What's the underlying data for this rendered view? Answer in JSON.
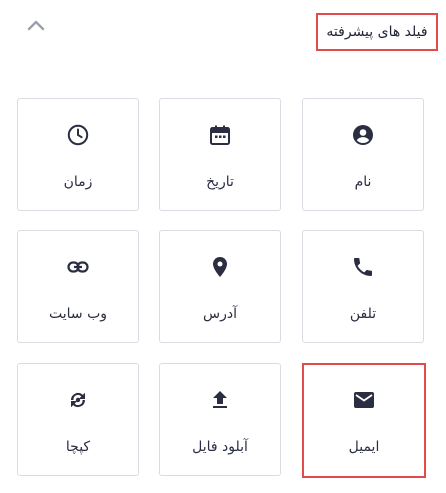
{
  "section": {
    "title": "فیلد های پیشرفته",
    "collapse_icon": "chevron-up-icon"
  },
  "fields": [
    {
      "id": "name",
      "label": "نام",
      "icon": "account-circle-icon"
    },
    {
      "id": "date",
      "label": "تاریخ",
      "icon": "calendar-icon"
    },
    {
      "id": "time",
      "label": "زمان",
      "icon": "clock-icon"
    },
    {
      "id": "phone",
      "label": "تلفن",
      "icon": "phone-icon"
    },
    {
      "id": "address",
      "label": "آدرس",
      "icon": "map-pin-icon"
    },
    {
      "id": "website",
      "label": "وب سایت",
      "icon": "link-icon"
    },
    {
      "id": "email",
      "label": "ایمیل",
      "icon": "mail-icon",
      "highlighted": true
    },
    {
      "id": "upload",
      "label": "آبلود فایل",
      "icon": "upload-icon"
    },
    {
      "id": "captcha",
      "label": "کپچا",
      "icon": "captcha-icon"
    }
  ],
  "colors": {
    "icon": "#2b2d42",
    "highlight": "#e24b4b",
    "border": "#d9dce3"
  }
}
